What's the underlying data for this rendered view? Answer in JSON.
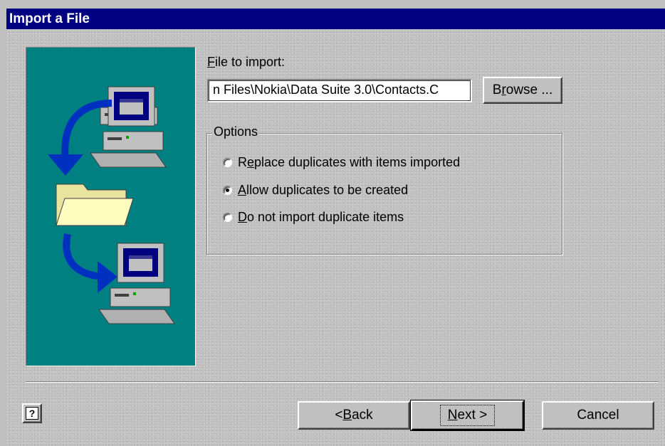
{
  "window": {
    "title": "Import a File"
  },
  "file": {
    "label_prefix": "",
    "label_accel": "F",
    "label_rest": "ile to import:",
    "value": "n Files\\Nokia\\Data Suite 3.0\\Contacts.C"
  },
  "browse": {
    "accel": "r",
    "pre": "B",
    "post": "owse ..."
  },
  "options": {
    "legend": "Options",
    "items": [
      {
        "pre": "R",
        "accel": "e",
        "post": "place duplicates with items imported",
        "selected": false
      },
      {
        "pre": "",
        "accel": "A",
        "post": "llow duplicates to be created",
        "selected": true
      },
      {
        "pre": "",
        "accel": "D",
        "post": "o not import duplicate items",
        "selected": false
      }
    ]
  },
  "footer": {
    "help_icon": "help-question-icon",
    "back_pre": "< ",
    "back_accel": "B",
    "back_post": "ack",
    "next_accel": "N",
    "next_post": "ext >",
    "cancel": "Cancel"
  },
  "colors": {
    "title_bar": "#000080",
    "art_bg": "#008080",
    "dialog_bg": "#c0c0c0"
  },
  "art_icons": [
    "computer-icon",
    "arrow-icon",
    "folder-icon",
    "arrow-icon",
    "computer-icon"
  ]
}
